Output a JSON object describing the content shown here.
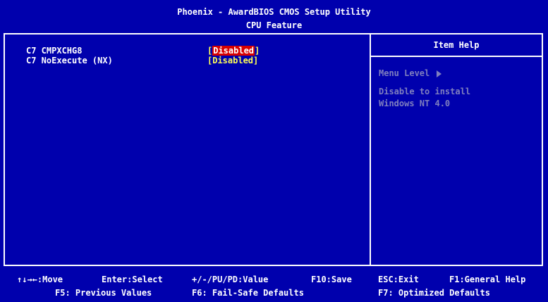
{
  "header": {
    "title": "Phoenix - AwardBIOS CMOS Setup Utility",
    "subtitle": "CPU Feature"
  },
  "options": [
    {
      "label": "C7 CMPXCHG8",
      "value": "Disabled",
      "selected": true
    },
    {
      "label": "C7 NoExecute (NX)",
      "value": "Disabled",
      "selected": false
    }
  ],
  "help": {
    "title": "Item Help",
    "menu_level_label": "Menu Level",
    "text_line1": "Disable to install",
    "text_line2": "Windows NT 4.0"
  },
  "footer": {
    "row1": [
      "↑↓→←:Move",
      "Enter:Select",
      "+/-/PU/PD:Value",
      "F10:Save",
      "ESC:Exit",
      "F1:General Help"
    ],
    "row2": [
      "F5: Previous Values",
      "F6: Fail-Safe Defaults",
      "F7: Optimized Defaults"
    ]
  },
  "colors": {
    "background": "#0000ad",
    "value_text": "#ffff55",
    "selected_highlight": "#d80000",
    "help_text": "#7f7fbe"
  }
}
